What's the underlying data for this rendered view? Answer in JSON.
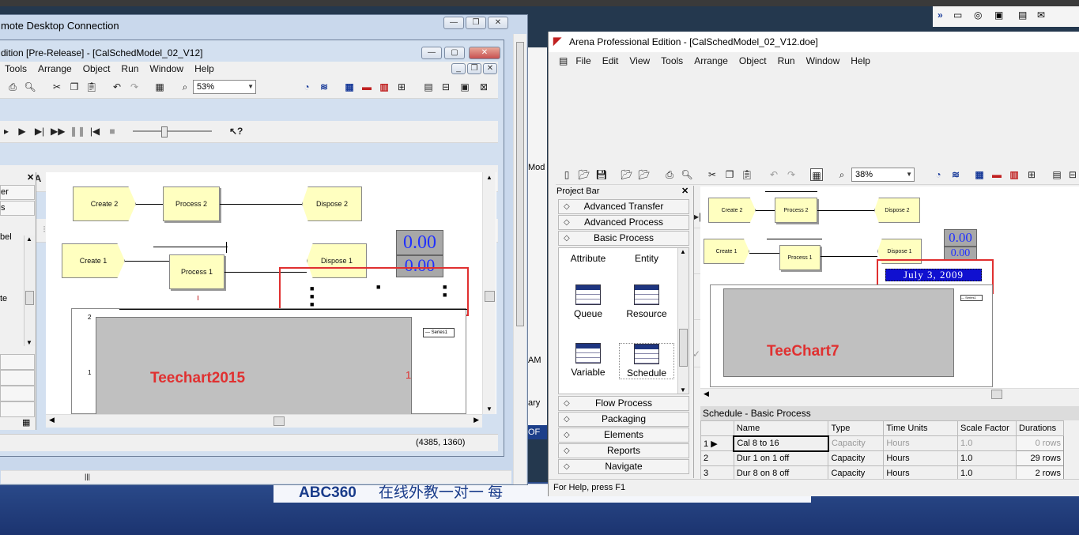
{
  "rdc": {
    "title": "mote Desktop Connection"
  },
  "left_app": {
    "title": "dition [Pre-Release]  - [CalSchedModel_02_V12]",
    "menu": [
      "Tools",
      "Arrange",
      "Object",
      "Run",
      "Window",
      "Help"
    ],
    "zoom": "53%",
    "project_bar_items": [
      "er",
      "s",
      "bel",
      "te"
    ],
    "modules": {
      "create2": "Create 2",
      "process2": "Process 2",
      "dispose2": "Dispose 2",
      "create1": "Create 1",
      "process1": "Process 1",
      "dispose1": "Dispose 1"
    },
    "digital_1": "0.00",
    "digital_2": "0.00",
    "chart_label": "Teechart2015",
    "chart_legend": "Series1",
    "chart_axis_2": "2",
    "chart_axis_1": "1",
    "chart_value_red": "1",
    "status_coords": "(4385, 1360)"
  },
  "middle_fragments": {
    "mod": "Mod",
    "am": "AM",
    "ary": "ary",
    "of": "OF"
  },
  "right_app": {
    "title": "Arena Professional Edition - [CalSchedModel_02_V12.doe]",
    "menu": [
      "File",
      "Edit",
      "View",
      "Tools",
      "Arrange",
      "Object",
      "Run",
      "Window",
      "Help"
    ],
    "zoom": "38%",
    "project_bar_title": "Project Bar",
    "panels_top": [
      "Advanced Transfer",
      "Advanced Process",
      "Basic Process"
    ],
    "basic_process_items": {
      "attribute": "Attribute",
      "entity": "Entity",
      "queue": "Queue",
      "resource": "Resource",
      "variable": "Variable",
      "schedule": "Schedule"
    },
    "panels_bottom": [
      "Flow Process",
      "Packaging",
      "Elements",
      "Reports",
      "Navigate"
    ],
    "modules": {
      "create2": "Create 2",
      "process2": "Process 2",
      "dispose2": "Dispose 2",
      "create1": "Create 1",
      "process1": "Process 1",
      "dispose1": "Dispose 1"
    },
    "digital_1": "0.00",
    "digital_2": "0.00",
    "date_display": "July 3, 2009",
    "chart_label": "TeeChart7",
    "chart_legend": "Series1",
    "spreadsheet_title": "Schedule - Basic Process",
    "columns": [
      "",
      "Name",
      "Type",
      "Time Units",
      "Scale Factor",
      "Durations"
    ],
    "rows": [
      {
        "num": "1",
        "name": "Cal 8 to 16",
        "type": "Capacity",
        "units": "Hours",
        "scale": "1.0",
        "dur": "0 rows"
      },
      {
        "num": "2",
        "name": "Dur 1 on 1 off",
        "type": "Capacity",
        "units": "Hours",
        "scale": "1.0",
        "dur": "29 rows"
      },
      {
        "num": "3",
        "name": "Dur 8 on 8 off",
        "type": "Capacity",
        "units": "Hours",
        "scale": "1.0",
        "dur": "2 rows"
      }
    ],
    "status": "For Help, press F1"
  },
  "banner": {
    "brand": "ABC360",
    "text": "在线外教一对一  每"
  },
  "colors": {
    "module_fill": "#ffffc0",
    "highlight_red": "#e03030",
    "digital_blue": "#2030ff",
    "date_bg": "#1010d0"
  }
}
